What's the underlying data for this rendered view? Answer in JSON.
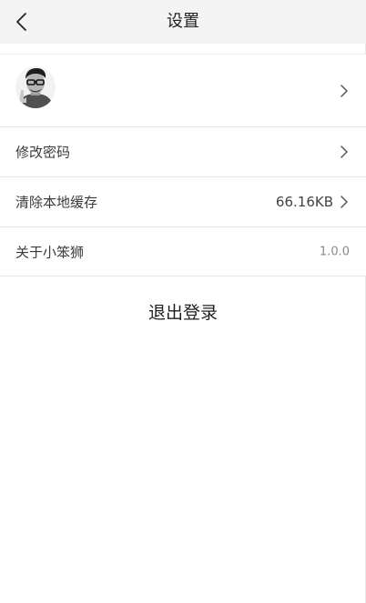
{
  "header": {
    "title": "设置",
    "back_icon": "chevron-left-icon"
  },
  "profile": {
    "avatar_icon": "user-avatar",
    "chevron_icon": "chevron-right-icon"
  },
  "settings": {
    "change_password": {
      "label": "修改密码"
    },
    "clear_cache": {
      "label": "清除本地缓存",
      "value": "66.16KB"
    },
    "about": {
      "label": "关于小笨狮",
      "value": "1.0.0"
    }
  },
  "logout": {
    "label": "退出登录"
  },
  "colors": {
    "header_bg": "#f4f4f4",
    "divider": "#e8e8e8",
    "text_primary": "#333333",
    "text_secondary": "#8a8a8a"
  }
}
